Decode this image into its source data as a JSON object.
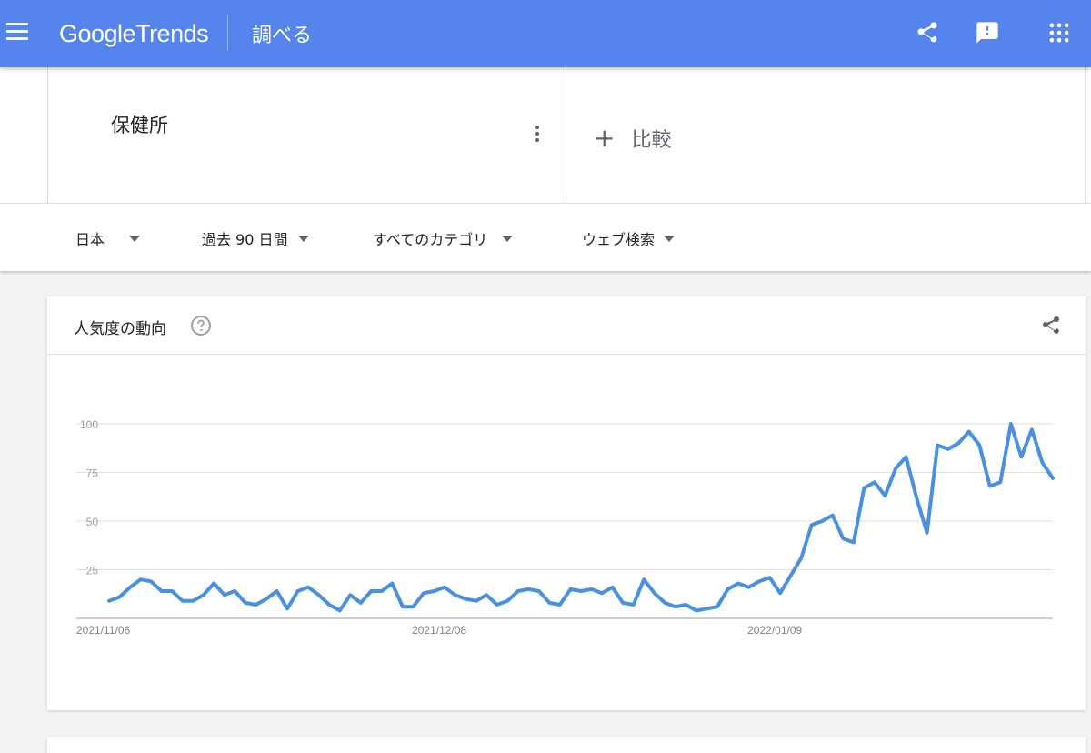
{
  "header": {
    "logo_google": "Google",
    "logo_trends": "Trends",
    "section": "調べる",
    "icons": [
      "menu-icon",
      "share-icon",
      "feedback-icon",
      "apps-icon"
    ],
    "colors": {
      "bar": "#5585ec",
      "line": "#4a90e2"
    }
  },
  "terms": {
    "term1": "保健所",
    "compare": "比較",
    "compare_icon": "+"
  },
  "filters": {
    "region": "日本",
    "period": "過去 90 日間",
    "category": "すべてのカテゴリ",
    "search_type": "ウェブ検索"
  },
  "card": {
    "title": "人気度の動向"
  },
  "chart_data": {
    "type": "line",
    "title": "",
    "xlabel": "",
    "ylabel": "",
    "ylim": [
      0,
      100
    ],
    "yticks": [
      25,
      50,
      75,
      100
    ],
    "x_tick_labels": [
      "2021/11/06",
      "2021/12/08",
      "2022/01/09"
    ],
    "x_start": "2021-11-06",
    "grid": true,
    "series": [
      {
        "color": "#4a90e2",
        "values": [
          9,
          11,
          16,
          20,
          19,
          14,
          14,
          9,
          9,
          12,
          18,
          12,
          14,
          8,
          7,
          10,
          14,
          5,
          14,
          16,
          12,
          7,
          4,
          12,
          8,
          14,
          14,
          18,
          6,
          6,
          13,
          14,
          16,
          12,
          10,
          9,
          12,
          7,
          9,
          14,
          15,
          14,
          8,
          7,
          15,
          14,
          15,
          13,
          16,
          8,
          7,
          20,
          13,
          8,
          6,
          7,
          4,
          5,
          6,
          15,
          18,
          16,
          19,
          21,
          13,
          22,
          31,
          48,
          50,
          53,
          41,
          39,
          67,
          70,
          63,
          77,
          83,
          62,
          44,
          89,
          87,
          90,
          96,
          89,
          68,
          70,
          100,
          83,
          97,
          80,
          72
        ]
      }
    ]
  }
}
